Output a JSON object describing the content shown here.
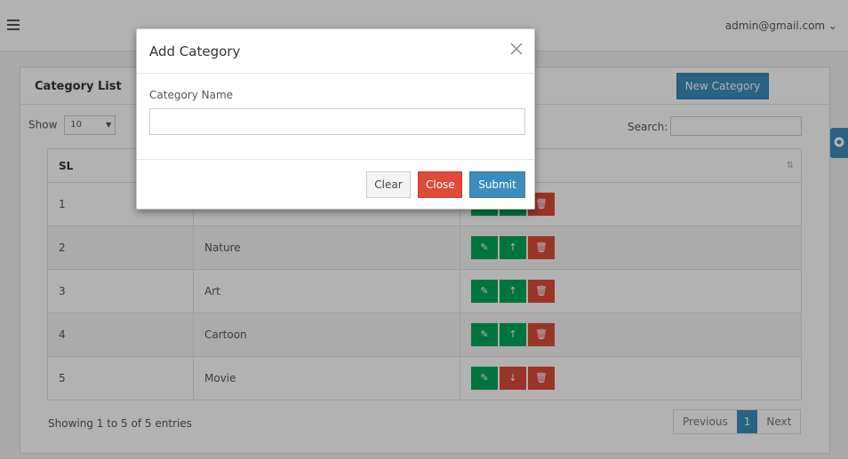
{
  "header": {
    "user_email": "admin@gmail.com ⌄"
  },
  "panel": {
    "title": "Category List",
    "new_button": "New Category",
    "show_label": "Show",
    "show_value": "10",
    "show_arrow": "▼",
    "search_label": "Search:",
    "search_value": ""
  },
  "table": {
    "columns": [
      "SL",
      "",
      ""
    ],
    "sort_icon": "⇅",
    "rows": [
      {
        "sl": "1",
        "name": "",
        "order_icon": "up-arrow-icon"
      },
      {
        "sl": "2",
        "name": "Nature",
        "order_icon": "up-arrow-icon"
      },
      {
        "sl": "3",
        "name": "Art",
        "order_icon": "up-arrow-icon"
      },
      {
        "sl": "4",
        "name": "Cartoon",
        "order_icon": "up-arrow-icon"
      },
      {
        "sl": "5",
        "name": "Movie",
        "order_icon": "down-arrow-icon"
      }
    ]
  },
  "footer": {
    "info": "Showing 1 to 5 of 5 entries",
    "prev": "Previous",
    "page": "1",
    "next": "Next"
  },
  "modal": {
    "title": "Add Category",
    "field_label": "Category Name",
    "field_value": "",
    "clear": "Clear",
    "close": "Close",
    "submit": "Submit"
  },
  "colors": {
    "primary": "#3c8dbc",
    "success": "#00a65a",
    "danger": "#dd4b39"
  }
}
